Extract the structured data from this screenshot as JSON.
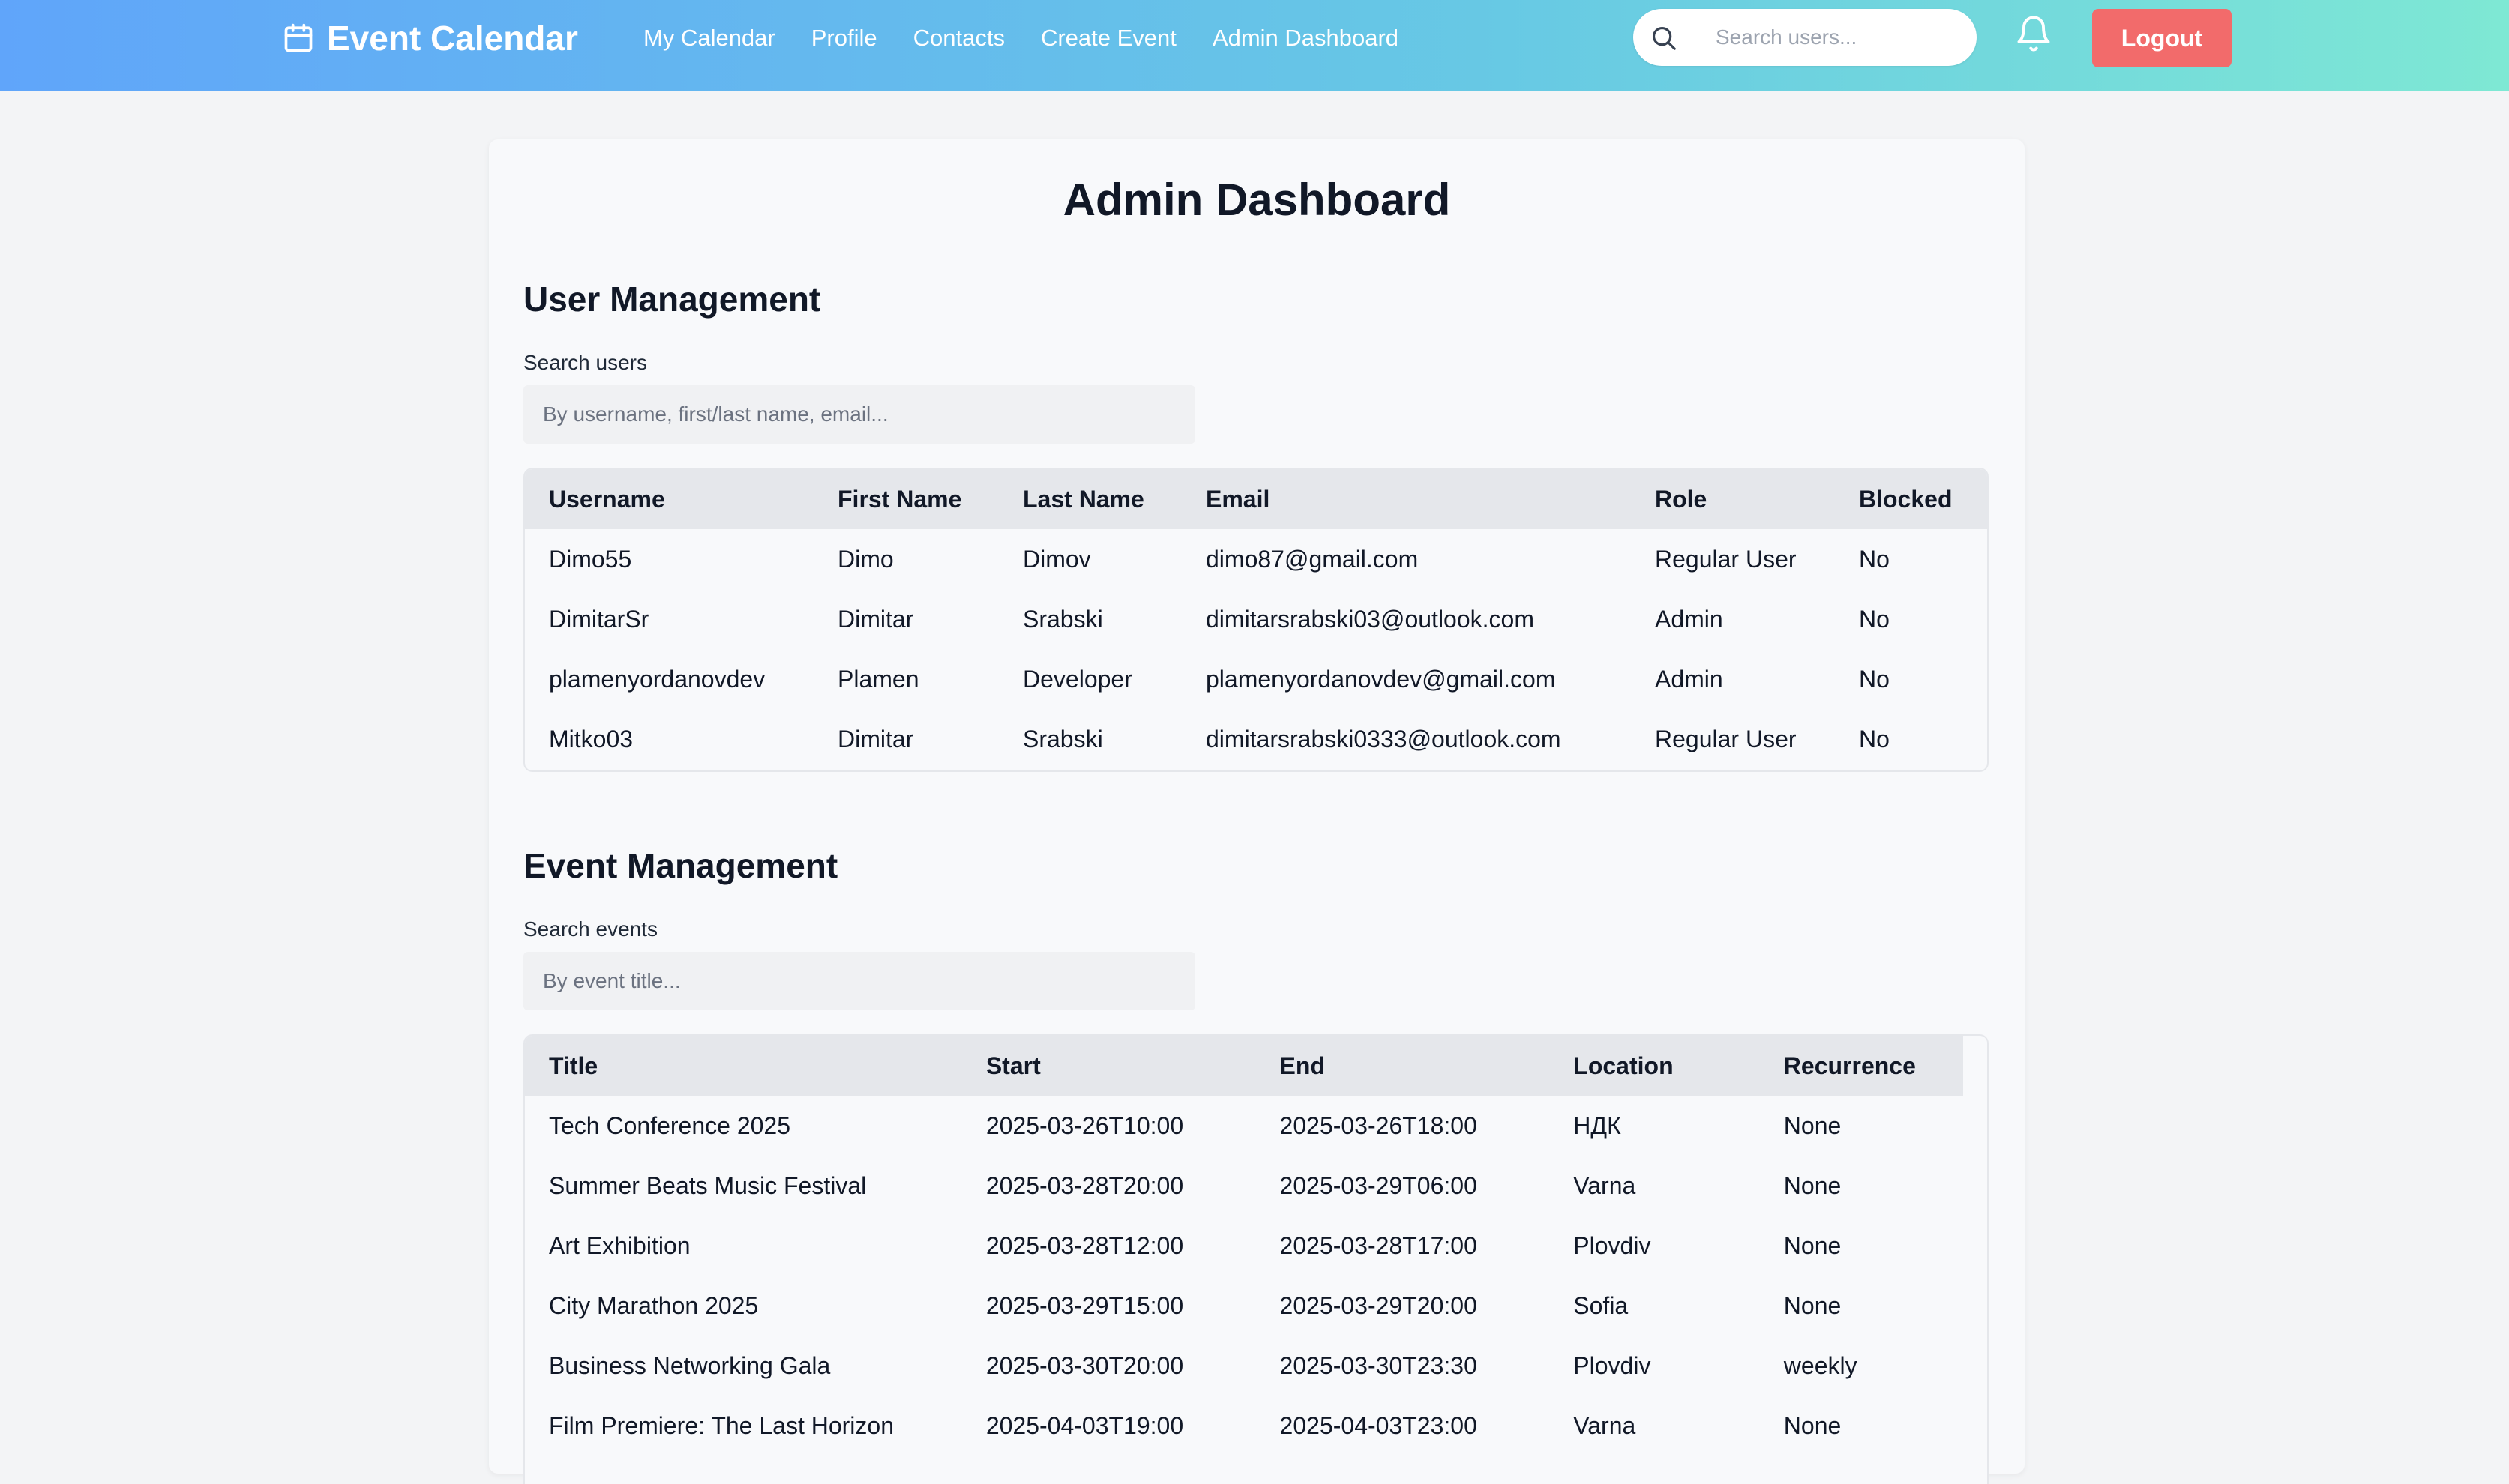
{
  "nav": {
    "brand": "Event Calendar",
    "links": [
      "My Calendar",
      "Profile",
      "Contacts",
      "Create Event",
      "Admin Dashboard"
    ],
    "search_placeholder": "Search users...",
    "logout_label": "Logout"
  },
  "page": {
    "title": "Admin Dashboard"
  },
  "users": {
    "section_title": "User Management",
    "search_label": "Search users",
    "search_placeholder": "By username, first/last name, email...",
    "columns": [
      "Username",
      "First Name",
      "Last Name",
      "Email",
      "Role",
      "Blocked"
    ],
    "rows": [
      [
        "Dimo55",
        "Dimo",
        "Dimov",
        "dimo87@gmail.com",
        "Regular User",
        "No"
      ],
      [
        "DimitarSr",
        "Dimitar",
        "Srabski",
        "dimitarsrabski03@outlook.com",
        "Admin",
        "No"
      ],
      [
        "plamenyordanovdev",
        "Plamen",
        "Developer",
        "plamenyordanovdev@gmail.com",
        "Admin",
        "No"
      ],
      [
        "Mitko03",
        "Dimitar",
        "Srabski",
        "dimitarsrabski0333@outlook.com",
        "Regular User",
        "No"
      ]
    ]
  },
  "events": {
    "section_title": "Event Management",
    "search_label": "Search events",
    "search_placeholder": "By event title...",
    "columns": [
      "Title",
      "Start",
      "End",
      "Location",
      "Recurrence"
    ],
    "rows": [
      [
        "Tech Conference 2025",
        "2025-03-26T10:00",
        "2025-03-26T18:00",
        "НДК",
        "None"
      ],
      [
        "Summer Beats Music Festival",
        "2025-03-28T20:00",
        "2025-03-29T06:00",
        "Varna",
        "None"
      ],
      [
        "Art Exhibition",
        "2025-03-28T12:00",
        "2025-03-28T17:00",
        "Plovdiv",
        "None"
      ],
      [
        "City Marathon 2025",
        "2025-03-29T15:00",
        "2025-03-29T20:00",
        "Sofia",
        "None"
      ],
      [
        "Business Networking Gala",
        "2025-03-30T20:00",
        "2025-03-30T23:30",
        "Plovdiv",
        "weekly"
      ],
      [
        "Film Premiere: The Last Horizon",
        "2025-04-03T19:00",
        "2025-04-03T23:00",
        "Varna",
        "None"
      ]
    ]
  }
}
